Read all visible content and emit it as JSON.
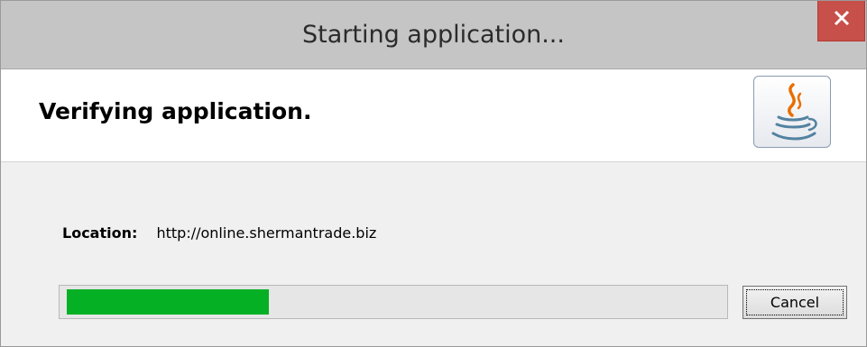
{
  "window": {
    "title": "Starting application..."
  },
  "header": {
    "heading": "Verifying application.",
    "logo_icon": "java-coffee-cup-icon"
  },
  "location": {
    "label": "Location:",
    "value": "http://online.shermantrade.biz"
  },
  "progress": {
    "fraction": 0.31,
    "color": "#06b025"
  },
  "buttons": {
    "cancel_label": "Cancel"
  },
  "colors": {
    "close_button": "#c7504a",
    "titlebar": "#c5c5c5"
  }
}
